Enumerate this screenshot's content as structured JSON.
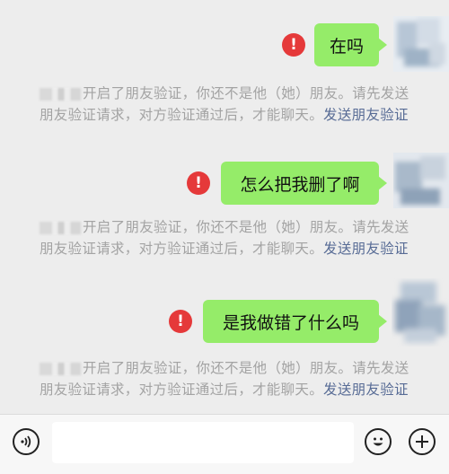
{
  "messages": [
    {
      "text": "在吗",
      "status": "failed"
    },
    {
      "text": "怎么把我删了啊",
      "status": "failed"
    },
    {
      "text": "是我做错了什么吗",
      "status": "failed"
    }
  ],
  "error_icon_glyph": "!",
  "notice": {
    "text": "开启了朋友验证，你还不是他（她）朋友。请先发送朋友验证请求，对方验证通过后，才能聊天。",
    "link": "发送朋友验证"
  },
  "input": {
    "placeholder": ""
  },
  "icons": {
    "voice": "voice-icon",
    "emoji": "emoji-icon",
    "plus": "plus-icon",
    "error": "exclamation-icon"
  },
  "colors": {
    "chat_background": "#ededed",
    "bubble": "#95ec69",
    "error": "#e5393a",
    "link": "#576b95",
    "notice_text": "#a3a3a3"
  }
}
